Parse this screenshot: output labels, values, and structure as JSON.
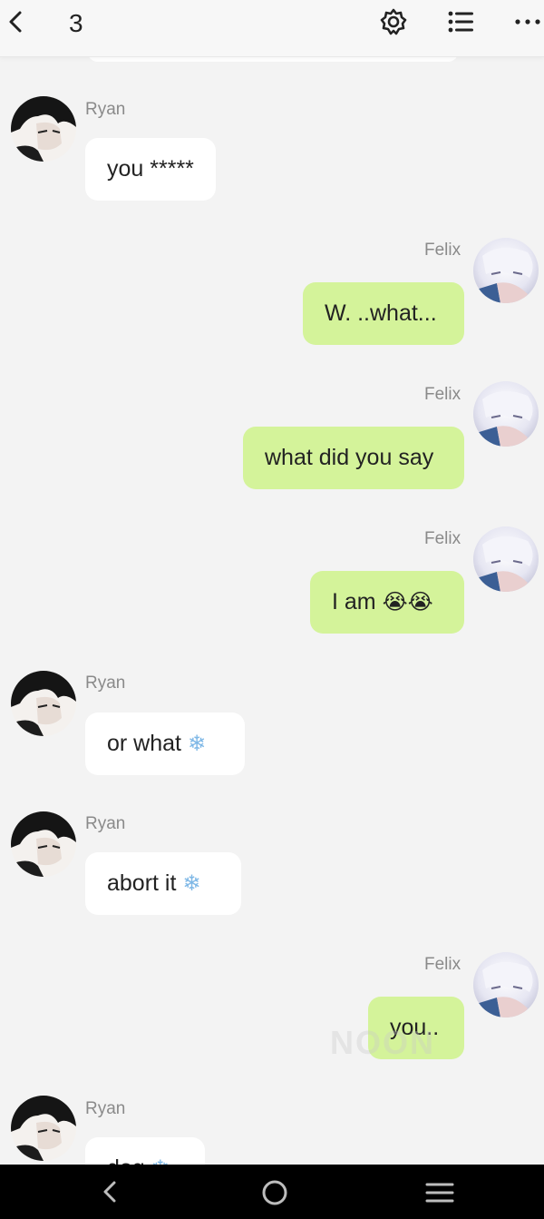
{
  "header": {
    "count": "3",
    "icons": [
      "back-arrow-icon",
      "gear-icon",
      "list-icon",
      "more-dots-icon"
    ]
  },
  "messages": [
    {
      "sender": "Ryan",
      "text": "you *****",
      "emoji": ""
    },
    {
      "sender": "Felix",
      "text": "W. ..what...",
      "emoji": ""
    },
    {
      "sender": "Felix",
      "text": "what did you say",
      "emoji": ""
    },
    {
      "sender": "Felix",
      "text": "I am ",
      "emoji": "😭😭"
    },
    {
      "sender": "Ryan",
      "text": "or what ",
      "emoji": "❄"
    },
    {
      "sender": "Ryan",
      "text": "abort it ",
      "emoji": "❄"
    },
    {
      "sender": "Felix",
      "text": "you..",
      "emoji": ""
    },
    {
      "sender": "Ryan",
      "text": "dog ",
      "emoji": "❄"
    }
  ],
  "watermark": "NOON",
  "nav": {
    "icons": [
      "nav-back-icon",
      "nav-home-icon",
      "nav-menu-icon"
    ]
  },
  "colors": {
    "outgoing_bubble": "#d4f39a",
    "incoming_bubble": "#ffffff",
    "background": "#f3f3f3"
  }
}
